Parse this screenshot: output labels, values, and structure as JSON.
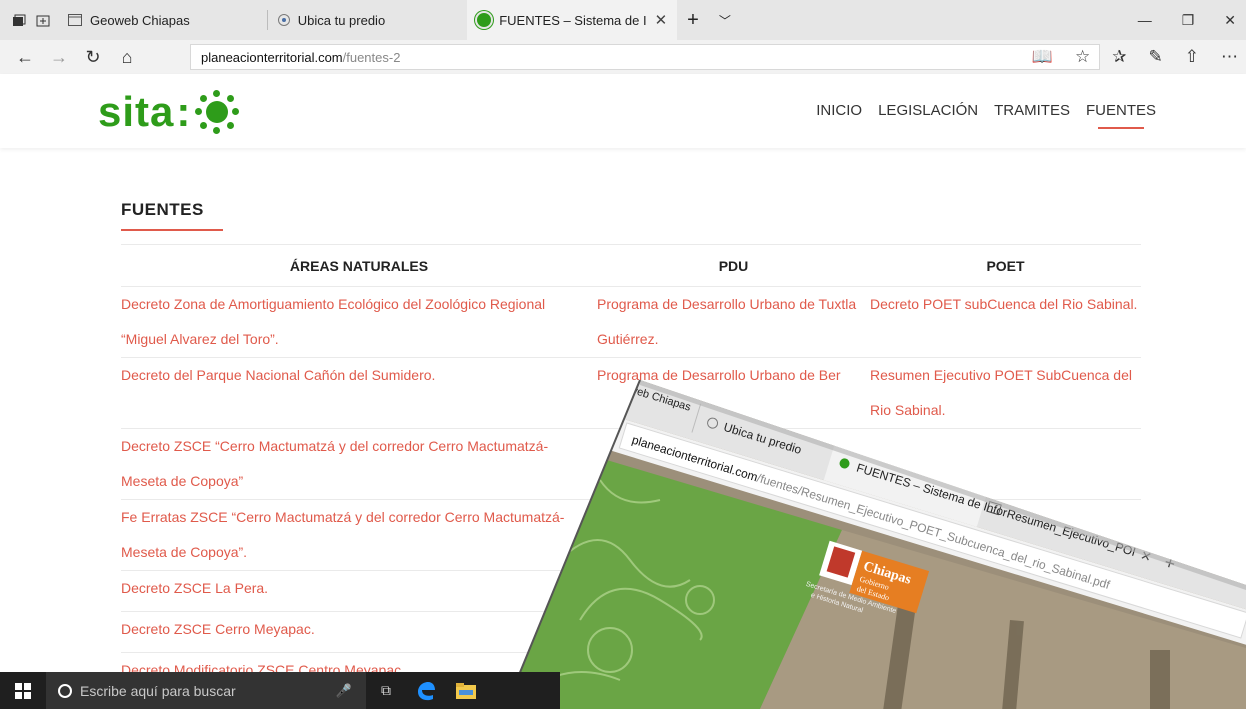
{
  "browser": {
    "tabs": [
      {
        "label": "Geoweb Chiapas",
        "active": false
      },
      {
        "label": "Ubica tu predio",
        "active": false
      },
      {
        "label": "FUENTES – Sistema de I",
        "active": true
      }
    ],
    "address": {
      "host": "planeacionterritorial.com",
      "path": "/fuentes-2"
    },
    "new_tab": "+",
    "tab_menu": "﹀"
  },
  "site": {
    "logo_text": "sita",
    "logo_colon": ":",
    "menu": [
      "INICIO",
      "LEGISLACIÓN",
      "TRAMITES",
      "FUENTES"
    ],
    "active_menu": "FUENTES"
  },
  "page": {
    "section_title": "FUENTES",
    "columns": [
      "ÁREAS NATURALES",
      "PDU",
      "POET"
    ],
    "rows": [
      {
        "c1": "Decreto Zona de Amortiguamiento Ecológico del Zoológico Regional “Miguel Alvarez del Toro”.",
        "c2": "Programa de Desarrollo Urbano de Tuxtla Gutiérrez.",
        "c3": "Decreto POET subCuenca del Rio Sabinal."
      },
      {
        "c1": "Decreto del Parque Nacional Cañón del Sumidero.",
        "c2": "Programa de Desarrollo Urbano de Ber",
        "c3": "Resumen Ejecutivo POET SubCuenca del Rio Sabinal."
      },
      {
        "c1": "Decreto ZSCE “Cerro Mactumatzá y del corredor Cerro Mactumatzá-Meseta de Copoya”",
        "c2": "",
        "c3": ""
      },
      {
        "c1": "Fe Erratas ZSCE “Cerro Mactumatzá y del corredor Cerro Mactumatzá-Meseta de Copoya”.",
        "c2": "",
        "c3": ""
      },
      {
        "c1": "Decreto ZSCE La Pera.",
        "c2": "",
        "c3": ""
      },
      {
        "c1": "Decreto ZSCE Cerro Meyapac.",
        "c2": "",
        "c3": ""
      },
      {
        "c1": "Decreto Modificatorio ZSCE Centro Meyapac",
        "c2": "",
        "c3": ""
      }
    ]
  },
  "overlay": {
    "tab1": "Geoweb Chiapas",
    "tab2": "Ubica tu predio",
    "tab3": "FUENTES – Sistema de Infor",
    "tab4": "Resumen_Ejecutivo_POI",
    "url_host": "planeacionterritorial.com",
    "url_path": "/fuentes/Resumen_Ejecutivo_POET_Subcuenca_del_rio_Sabinal.pdf",
    "doc_brand": "Chiapas",
    "doc_brand_sub1": "Gobierno",
    "doc_brand_sub2": "del Estado",
    "doc_secretaria1": "Secretaría de Medio Ambiente",
    "doc_secretaria2": "e Historia Natural"
  },
  "taskbar": {
    "search_placeholder": "Escribe aquí para buscar"
  },
  "colors": {
    "accent": "#e05a4b",
    "brand_green": "#2e9c1a",
    "doc_green": "#6aa545"
  }
}
